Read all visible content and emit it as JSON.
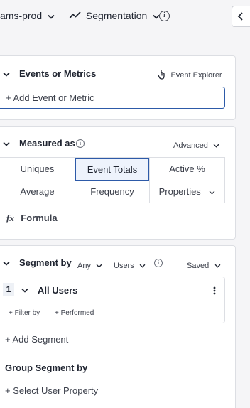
{
  "topbar": {
    "project": "ams-prod",
    "chart_type": "Segmentation"
  },
  "events_section": {
    "title": "Events or Metrics",
    "explorer_label": "Event Explorer",
    "add_placeholder": "+ Add Event or Metric"
  },
  "measured_section": {
    "title": "Measured as",
    "advanced_label": "Advanced",
    "options": [
      "Uniques",
      "Event Totals",
      "Active %",
      "Average",
      "Frequency",
      "Properties"
    ],
    "selected": "Event Totals",
    "formula_icon": "fx",
    "formula_label": "Formula"
  },
  "segment_section": {
    "title": "Segment by",
    "any_label": "Any",
    "users_label": "Users",
    "saved_label": "Saved",
    "segment_number": "1",
    "segment_name": "All Users",
    "filter_by": "+ Filter by",
    "performed": "+ Performed",
    "add_segment": "+ Add Segment",
    "group_title": "Group Segment by",
    "select_property": "+ Select User Property"
  },
  "colors": {
    "accent": "#2d5aa8",
    "selected_bg": "#eef3fc",
    "border": "#dcdee3"
  }
}
